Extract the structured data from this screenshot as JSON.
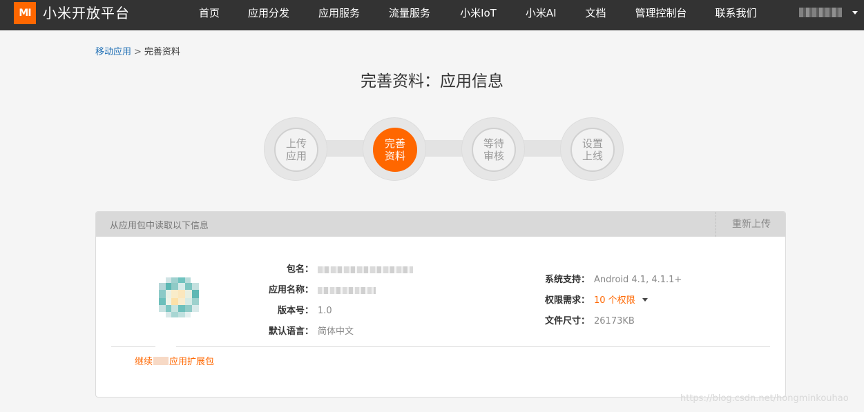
{
  "header": {
    "logo_text": "MI",
    "brand": "小米开放平台",
    "nav": [
      "首页",
      "应用分发",
      "应用服务",
      "流量服务",
      "小米IoT",
      "小米AI",
      "文档",
      "管理控制台",
      "联系我们"
    ],
    "accent_color": "#ff6700"
  },
  "breadcrumb": {
    "parent": "移动应用",
    "separator": ">",
    "current": "完善资料"
  },
  "page_title": "完善资料：应用信息",
  "steps": [
    {
      "line1": "上传",
      "line2": "应用",
      "active": false
    },
    {
      "line1": "完善",
      "line2": "资料",
      "active": true
    },
    {
      "line1": "等待",
      "line2": "审核",
      "active": false
    },
    {
      "line1": "设置",
      "line2": "上线",
      "active": false
    }
  ],
  "panel": {
    "title": "从应用包中读取以下信息",
    "reupload": "重新上传",
    "left_fields": {
      "package_label": "包名：",
      "app_name_label": "应用名称：",
      "version_label": "版本号：",
      "version_value": "1.0",
      "language_label": "默认语言：",
      "language_value": "简体中文"
    },
    "right_fields": {
      "system_label": "系统支持：",
      "system_value": "Android 4.1, 4.1.1+",
      "permission_label": "权限需求：",
      "permission_value": "10 个权限",
      "filesize_label": "文件尺寸：",
      "filesize_value": "26173KB"
    },
    "expand_link_prefix": "继续",
    "expand_link_suffix": "应用扩展包"
  },
  "watermark": "https://blog.csdn.net/hongminkouhao"
}
